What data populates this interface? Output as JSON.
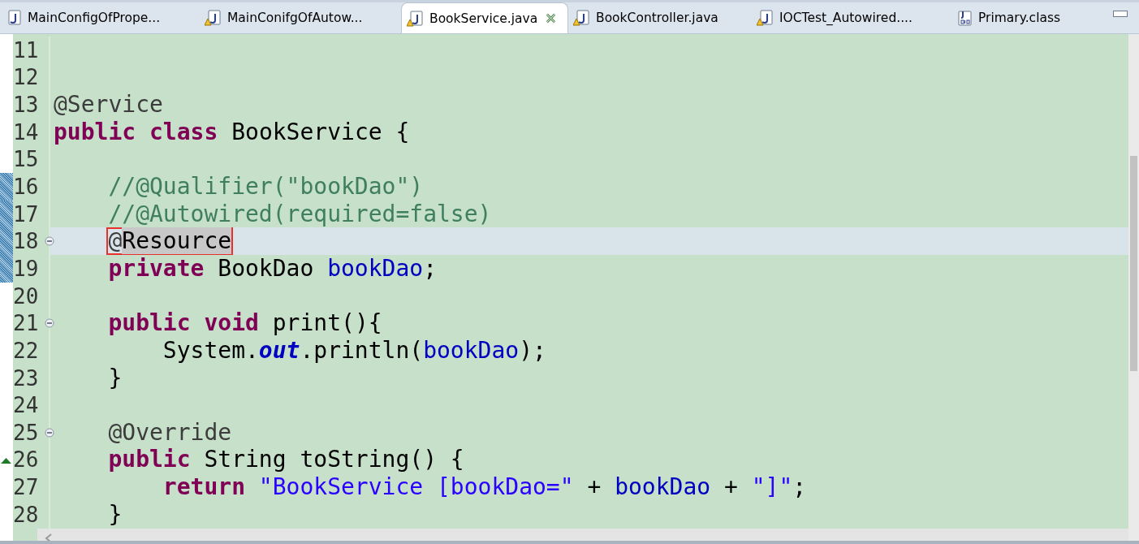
{
  "tabs": [
    {
      "label": "MainConfigOfPrope...",
      "kind": "java",
      "selected": false
    },
    {
      "label": "MainConifgOfAutow...",
      "kind": "java-warning",
      "selected": false
    },
    {
      "label": "BookService.java",
      "kind": "java-warning",
      "selected": true
    },
    {
      "label": "BookController.java",
      "kind": "java-warning",
      "selected": false
    },
    {
      "label": "IOCTest_Autowired....",
      "kind": "java-warning",
      "selected": false
    },
    {
      "label": "Primary.class",
      "kind": "class",
      "selected": false
    }
  ],
  "lines": [
    {
      "number": "11"
    },
    {
      "number": "12"
    },
    {
      "number": "13",
      "tokens": [
        {
          "kind": "annotation",
          "text": "@Service"
        }
      ]
    },
    {
      "number": "14",
      "tokens": [
        {
          "kind": "keyword",
          "text": "public"
        },
        {
          "kind": "keyword",
          "text": " class"
        },
        {
          "kind": "plain",
          "text": " BookService {"
        }
      ]
    },
    {
      "number": "15"
    },
    {
      "number": "16",
      "markers": [
        {
          "kind": "change"
        }
      ],
      "tokens": [
        {
          "kind": "comment",
          "text": "    //@Qualifier(\"bookDao\")"
        }
      ]
    },
    {
      "number": "17",
      "markers": [
        {
          "kind": "change"
        }
      ],
      "tokens": [
        {
          "kind": "comment",
          "text": "    //@Autowired(required=false)"
        }
      ]
    },
    {
      "number": "18",
      "markers": [
        {
          "kind": "change"
        },
        {
          "kind": "fold"
        },
        {
          "kind": "current-line"
        },
        {
          "kind": "callout"
        }
      ],
      "tokens": [
        {
          "kind": "annotation",
          "text": "    @"
        },
        {
          "kind": "occurrence",
          "text": "Resource"
        }
      ]
    },
    {
      "number": "19",
      "markers": [
        {
          "kind": "change"
        }
      ],
      "tokens": [
        {
          "kind": "keyword",
          "text": "    private"
        },
        {
          "kind": "plain",
          "text": " BookDao "
        },
        {
          "kind": "field",
          "text": "bookDao"
        },
        {
          "kind": "plain",
          "text": ";"
        }
      ]
    },
    {
      "number": "20"
    },
    {
      "number": "21",
      "markers": [
        {
          "kind": "fold"
        }
      ],
      "tokens": [
        {
          "kind": "keyword",
          "text": "    public"
        },
        {
          "kind": "keyword",
          "text": " void"
        },
        {
          "kind": "plain",
          "text": " print(){"
        }
      ]
    },
    {
      "number": "22",
      "tokens": [
        {
          "kind": "plain",
          "text": "        System."
        },
        {
          "kind": "static",
          "text": "out"
        },
        {
          "kind": "plain",
          "text": ".println("
        },
        {
          "kind": "field",
          "text": "bookDao"
        },
        {
          "kind": "plain",
          "text": ");"
        }
      ]
    },
    {
      "number": "23",
      "tokens": [
        {
          "kind": "plain",
          "text": "    }"
        }
      ]
    },
    {
      "number": "24"
    },
    {
      "number": "25",
      "markers": [
        {
          "kind": "fold"
        }
      ],
      "tokens": [
        {
          "kind": "annotation",
          "text": "    @Override"
        }
      ]
    },
    {
      "number": "26",
      "markers": [
        {
          "kind": "override"
        }
      ],
      "tokens": [
        {
          "kind": "keyword",
          "text": "    public"
        },
        {
          "kind": "plain",
          "text": " String toString() {"
        }
      ]
    },
    {
      "number": "27",
      "tokens": [
        {
          "kind": "keyword",
          "text": "        return"
        },
        {
          "kind": "string",
          "text": " \"BookService [bookDao=\""
        },
        {
          "kind": "plain",
          "text": " + "
        },
        {
          "kind": "field",
          "text": "bookDao"
        },
        {
          "kind": "plain",
          "text": " + "
        },
        {
          "kind": "string",
          "text": "\"]\""
        },
        {
          "kind": "plain",
          "text": ";"
        }
      ]
    },
    {
      "number": "28",
      "tokens": [
        {
          "kind": "plain",
          "text": "    }"
        }
      ]
    }
  ]
}
